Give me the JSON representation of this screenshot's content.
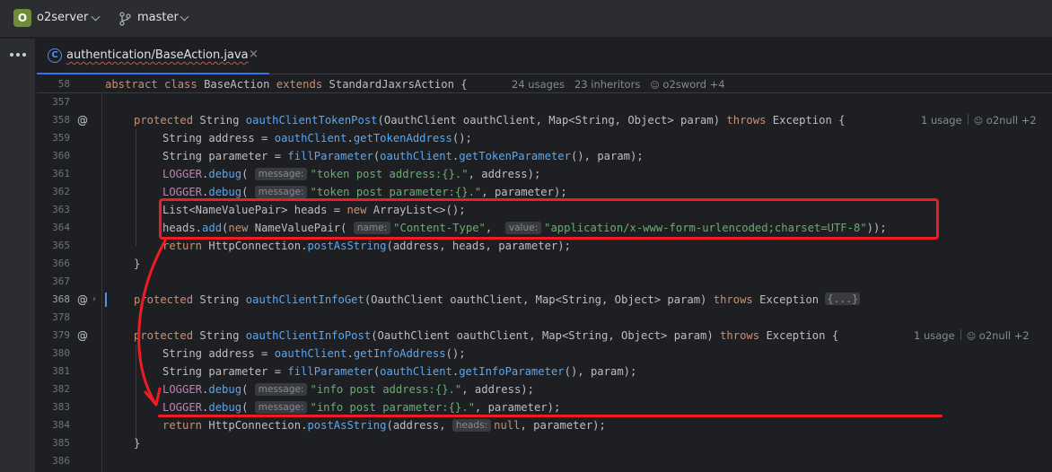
{
  "titlebar": {
    "project_badge": "O",
    "project_name": "o2server",
    "branch_name": "master"
  },
  "tabs": [
    {
      "label": "authentication/BaseAction.java",
      "icon": "java-class-icon",
      "close": "×"
    }
  ],
  "sticky": {
    "line_number": "58",
    "meta": [
      "24 usages",
      "23 inheritors",
      "o2sword +4"
    ]
  },
  "lines": [
    {
      "n": "357"
    },
    {
      "n": "358",
      "meta": [
        "1 usage",
        "o2null +2"
      ]
    },
    {
      "n": "359"
    },
    {
      "n": "360"
    },
    {
      "n": "361"
    },
    {
      "n": "362"
    },
    {
      "n": "363"
    },
    {
      "n": "364"
    },
    {
      "n": "365"
    },
    {
      "n": "366"
    },
    {
      "n": "367"
    },
    {
      "n": "368"
    },
    {
      "n": "378"
    },
    {
      "n": "379",
      "meta": [
        "1 usage",
        "o2null +2"
      ]
    },
    {
      "n": "380"
    },
    {
      "n": "381"
    },
    {
      "n": "382"
    },
    {
      "n": "383"
    },
    {
      "n": "384"
    },
    {
      "n": "385"
    },
    {
      "n": "386"
    }
  ],
  "code": {
    "sticky": {
      "abstract": "abstract",
      "class": "class",
      "name": "BaseAction",
      "extends": "extends",
      "parent": "StandardJaxrsAction",
      "brace": "{"
    },
    "l358": {
      "mod": "protected",
      "type": "String",
      "fn": "oauthClientTokenPost",
      "p1": "(OauthClient oauthClient, Map<String, Object> param) ",
      "throws": "throws",
      "exc": " Exception {"
    },
    "l359": {
      "a": "String address = ",
      "obj": "oauthClient",
      "dot": ".",
      "fn": "getTokenAddress",
      "b": "();"
    },
    "l360": {
      "a": "String parameter = ",
      "fn": "fillParameter",
      "b": "(",
      "obj": "oauthClient",
      "dot": ".",
      "fn2": "getTokenParameter",
      "c": "(), param);"
    },
    "l361": {
      "logger": "LOGGER",
      "dot": ".",
      "fn": "debug",
      "open": "(",
      "hint": "message:",
      "str": "\"token post address:{}.\"",
      "rest": ", address);"
    },
    "l362": {
      "logger": "LOGGER",
      "dot": ".",
      "fn": "debug",
      "open": "(",
      "hint": "message:",
      "str": "\"token post parameter:{}.\"",
      "rest": ", parameter);"
    },
    "l363": {
      "a": "List<NameValuePair> heads = ",
      "new": "new",
      "b": " ArrayList<>();"
    },
    "l364": {
      "a": "heads.",
      "fn": "add",
      "b": "(",
      "new": "new",
      "c": " NameValuePair(",
      "hint1": "name:",
      "str1": "\"Content-Type\"",
      "comma": ", ",
      "hint2": "value:",
      "str2": "\"application/x-www-form-urlencoded;charset=UTF-8\"",
      "end": "));"
    },
    "l365": {
      "ret": "return",
      "a": " HttpConnection.",
      "fn": "postAsString",
      "b": "(address, heads, parameter);"
    },
    "l366": {
      "brace": "}"
    },
    "l368": {
      "mod": "protected",
      "type": "String",
      "fn": "oauthClientInfoGet",
      "p1": "(OauthClient oauthClient, Map<String, Object> param) ",
      "throws": "throws",
      "exc": " Exception ",
      "fold": "{...}"
    },
    "l379": {
      "mod": "protected",
      "type": "String",
      "fn": "oauthClientInfoPost",
      "p1": "(OauthClient oauthClient, Map<String, Object> param) ",
      "throws": "throws",
      "exc": " Exception {"
    },
    "l380": {
      "a": "String address = ",
      "obj": "oauthClient",
      "dot": ".",
      "fn": "getInfoAddress",
      "b": "();"
    },
    "l381": {
      "a": "String parameter = ",
      "fn": "fillParameter",
      "b": "(",
      "obj": "oauthClient",
      "dot": ".",
      "fn2": "getInfoParameter",
      "c": "(), param);"
    },
    "l382": {
      "logger": "LOGGER",
      "dot": ".",
      "fn": "debug",
      "open": "(",
      "hint": "message:",
      "str": "\"info post address:{}.\"",
      "rest": ", address);"
    },
    "l383": {
      "logger": "LOGGER",
      "dot": ".",
      "fn": "debug",
      "open": "(",
      "hint": "message:",
      "str": "\"info post parameter:{}.\"",
      "rest": ", parameter);"
    },
    "l384": {
      "ret": "return",
      "a": " HttpConnection.",
      "fn": "postAsString",
      "b": "(address, ",
      "hint": "heads:",
      "null": "null",
      "c": ", parameter);"
    },
    "l385": {
      "brace": "}"
    }
  },
  "colors": {
    "annotation": "#ee1c25",
    "keyword": "#cf8e6d",
    "method": "#56a8f5",
    "string": "#6aab73",
    "field": "#c77dbb"
  }
}
